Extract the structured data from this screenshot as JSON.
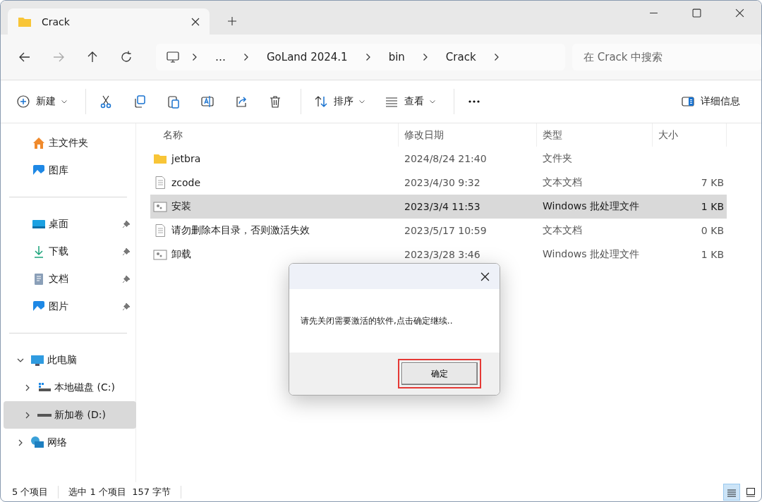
{
  "tabs": [
    {
      "title": "Crack",
      "selected": true
    }
  ],
  "breadcrumbs": [
    "…",
    "GoLand 2024.1",
    "bin",
    "Crack"
  ],
  "search": {
    "placeholder": "在 Crack 中搜索"
  },
  "toolbar": [
    {
      "kind": "new",
      "label": "新建"
    },
    {
      "kind": "sep"
    },
    {
      "kind": "cut"
    },
    {
      "kind": "copy"
    },
    {
      "kind": "paste"
    },
    {
      "kind": "rename"
    },
    {
      "kind": "share"
    },
    {
      "kind": "delete"
    },
    {
      "kind": "sep"
    },
    {
      "kind": "sort",
      "label": "排序"
    },
    {
      "kind": "view",
      "label": "查看"
    },
    {
      "kind": "sep"
    },
    {
      "kind": "more"
    }
  ],
  "details_button": {
    "label": "详细信息"
  },
  "sidebar": {
    "top": [
      {
        "kind": "home",
        "label": "主文件夹"
      },
      {
        "kind": "gallery",
        "label": "图库"
      }
    ],
    "quick": [
      {
        "kind": "desktop",
        "label": "桌面",
        "pinned": true
      },
      {
        "kind": "download",
        "label": "下载",
        "pinned": true
      },
      {
        "kind": "document",
        "label": "文档",
        "pinned": true
      },
      {
        "kind": "picture",
        "label": "图片",
        "pinned": true
      }
    ],
    "tree": [
      {
        "kind": "pc",
        "label": "此电脑",
        "expanded": true,
        "selected": false,
        "children": [
          {
            "kind": "system-drive",
            "label": "本地磁盘 (C:)",
            "expanded": false,
            "selected": false
          },
          {
            "kind": "drive",
            "label": "新加卷 (D:)",
            "expanded": false,
            "selected": true
          }
        ]
      },
      {
        "kind": "network",
        "label": "网络",
        "expanded": false,
        "selected": false
      }
    ]
  },
  "columns": [
    "名称",
    "修改日期",
    "类型",
    "大小"
  ],
  "rows": [
    {
      "kind": "folder",
      "name": "jetbra",
      "date": "2024/8/24 21:40",
      "type": "文件夹",
      "selected": false
    },
    {
      "kind": "text",
      "name": "zcode",
      "date": "2023/4/30 9:32",
      "type": "文本文档",
      "size": "7 KB",
      "selected": false
    },
    {
      "kind": "batch",
      "name": "安装",
      "date": "2023/3/4 11:53",
      "type": "Windows 批处理文件",
      "size": "1 KB",
      "selected": true
    },
    {
      "kind": "text",
      "name": "请勿删除本目录，否则激活失效",
      "date": "2023/5/17 10:59",
      "type": "文本文档",
      "size": "0 KB",
      "selected": false
    },
    {
      "kind": "batch",
      "name": "卸载",
      "date": "2023/3/28 3:46",
      "type": "Windows 批处理文件",
      "size": "1 KB",
      "selected": false
    }
  ],
  "dialog": {
    "message": "请先关闭需要激活的软件,点击确定继续..",
    "button": {
      "label": "确定",
      "highlighted": true
    }
  },
  "status_bar": [
    "5 个项目",
    "选中 1 个项目  157 字节"
  ],
  "view_buttons": [
    {
      "kind": "details",
      "selected": true
    },
    {
      "kind": "tiles",
      "selected": false
    }
  ]
}
